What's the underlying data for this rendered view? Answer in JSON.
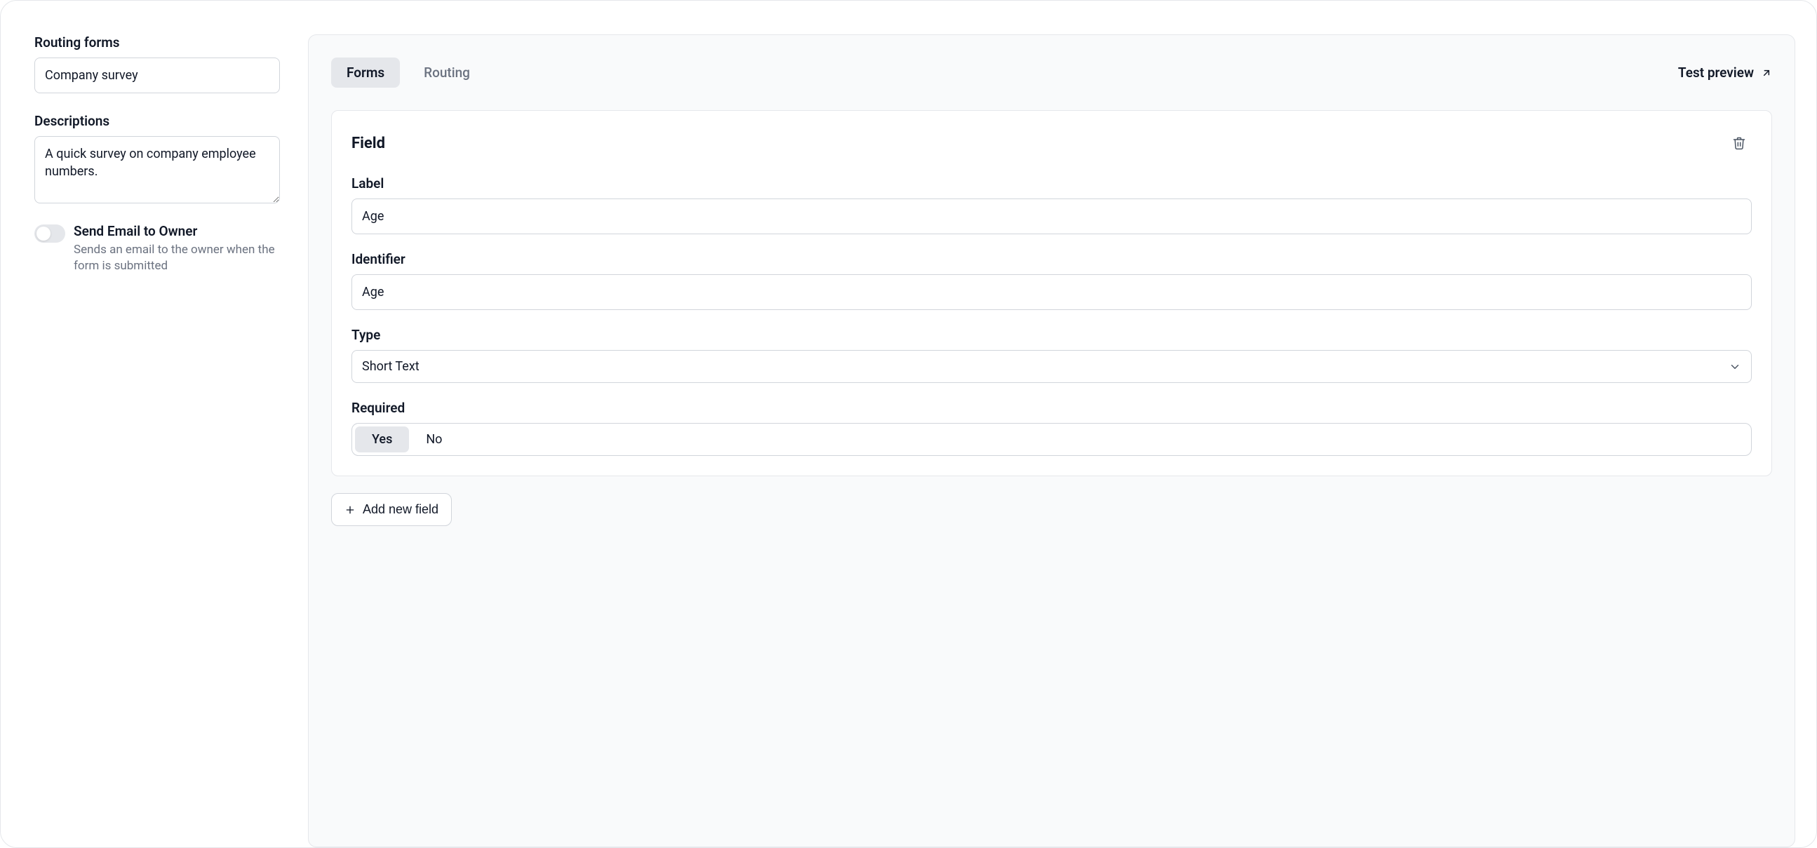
{
  "sidebar": {
    "title_label": "Routing forms",
    "title_value": "Company survey",
    "descriptions_label": "Descriptions",
    "descriptions_value": "A quick survey on company employee numbers.",
    "send_email_title": "Send Email to Owner",
    "send_email_desc": "Sends an email to the owner when the form is submitted",
    "send_email_enabled": false
  },
  "main": {
    "tabs": {
      "forms": "Forms",
      "routing": "Routing",
      "active": "forms"
    },
    "test_preview_label": "Test preview",
    "field_card": {
      "title": "Field",
      "label_label": "Label",
      "label_value": "Age",
      "identifier_label": "Identifier",
      "identifier_value": "Age",
      "type_label": "Type",
      "type_value": "Short Text",
      "required_label": "Required",
      "required_options": {
        "yes": "Yes",
        "no": "No"
      },
      "required_selected": "yes"
    },
    "add_field_label": "Add new field"
  }
}
